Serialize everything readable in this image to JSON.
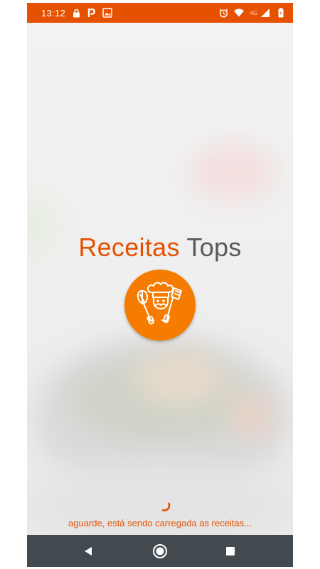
{
  "status_bar": {
    "time": "13:12",
    "network": "4G",
    "icons_left": [
      "lock-icon",
      "parking-icon",
      "image-icon"
    ],
    "icons_right": [
      "alarm-icon",
      "wifi-icon",
      "signal-icon",
      "battery-icon"
    ]
  },
  "app": {
    "title_part1": "Receitas",
    "title_part2": "Tops",
    "logo_icon": "chef-logo-icon",
    "loading_text": "aguarde, está sendo carregada as receitas..."
  },
  "nav_bar": {
    "buttons": [
      "back-icon",
      "home-icon",
      "recents-icon"
    ]
  },
  "colors": {
    "accent": "#e65100",
    "logo_bg": "#f57c00",
    "nav_bg": "#424a50"
  }
}
